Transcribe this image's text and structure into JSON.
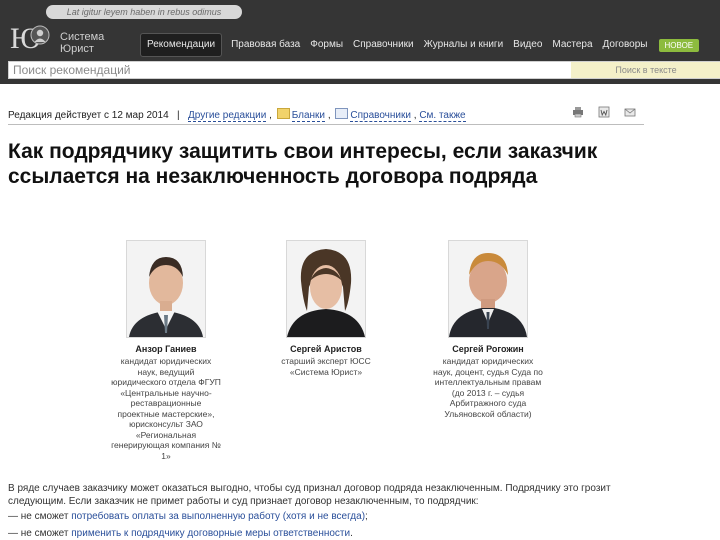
{
  "header": {
    "tooltip": "Lat igitur leyem haben in rebus odimus",
    "logo": {
      "glyph": "Ю",
      "line1": "Система",
      "line2": "Юрист"
    },
    "nav": [
      {
        "label": "Рекомендации",
        "active": true
      },
      {
        "label": "Правовая база"
      },
      {
        "label": "Формы"
      },
      {
        "label": "Справочники"
      },
      {
        "label": "Журналы и книги"
      },
      {
        "label": "Видео"
      },
      {
        "label": "Мастера"
      },
      {
        "label": "Договоры"
      }
    ],
    "new_badge": "НОВОЕ"
  },
  "search": {
    "placeholder": "Поиск рекомендаций",
    "in_text_label": "Поиск в тексте"
  },
  "edition": {
    "acts_since": "Редакция действует с 12 мар 2014",
    "other_editions": "Другие редакции",
    "blanks": "Бланки",
    "references": "Справочники",
    "see_also": "См. также"
  },
  "article": {
    "title": "Как подрядчику защитить свои интересы, если заказчик ссылается на незаключенность договора подряда"
  },
  "authors": [
    {
      "name": "Анзор Ганиев",
      "description": "кандидат юридических наук, ведущий юридического отдела ФГУП «Центральные научно-реставрационные проектные мастерские», юрисконсульт ЗАО «Региональная генерирующая компания № 1»"
    },
    {
      "name": "Сергей Аристов",
      "description": "старший эксперт ЮСС «Система Юрист»"
    },
    {
      "name": "Сергей Рогожин",
      "description": "кандидат юридических наук, доцент, судья Суда по интеллектуальным правам (до 2013 г. – судья Арбитражного суда Ульяновской области)"
    }
  ],
  "body": {
    "intro": "В ряде случаев заказчику может оказаться выгодно, чтобы суд признал договор подряда незаключенным. Подрядчику это грозит следующим. Если заказчик не примет работы и суд признает договор незаключенным, то подрядчик:",
    "item1_prefix": "— не сможет ",
    "item1_link": "потребовать оплаты за выполненную работу (хотя и не всегда)",
    "item1_suffix": ";",
    "item2_prefix": "— не сможет ",
    "item2_link": "применить к подрядчику договорные меры ответственности",
    "item2_suffix": "."
  },
  "icons": {
    "print": "print-icon",
    "word": "word-export-icon",
    "email": "email-icon"
  },
  "colors": {
    "header_bg": "#353535",
    "link": "#2a4f9a",
    "new_badge": "#8dbb3e",
    "search_highlight": "#f4f0c9"
  }
}
